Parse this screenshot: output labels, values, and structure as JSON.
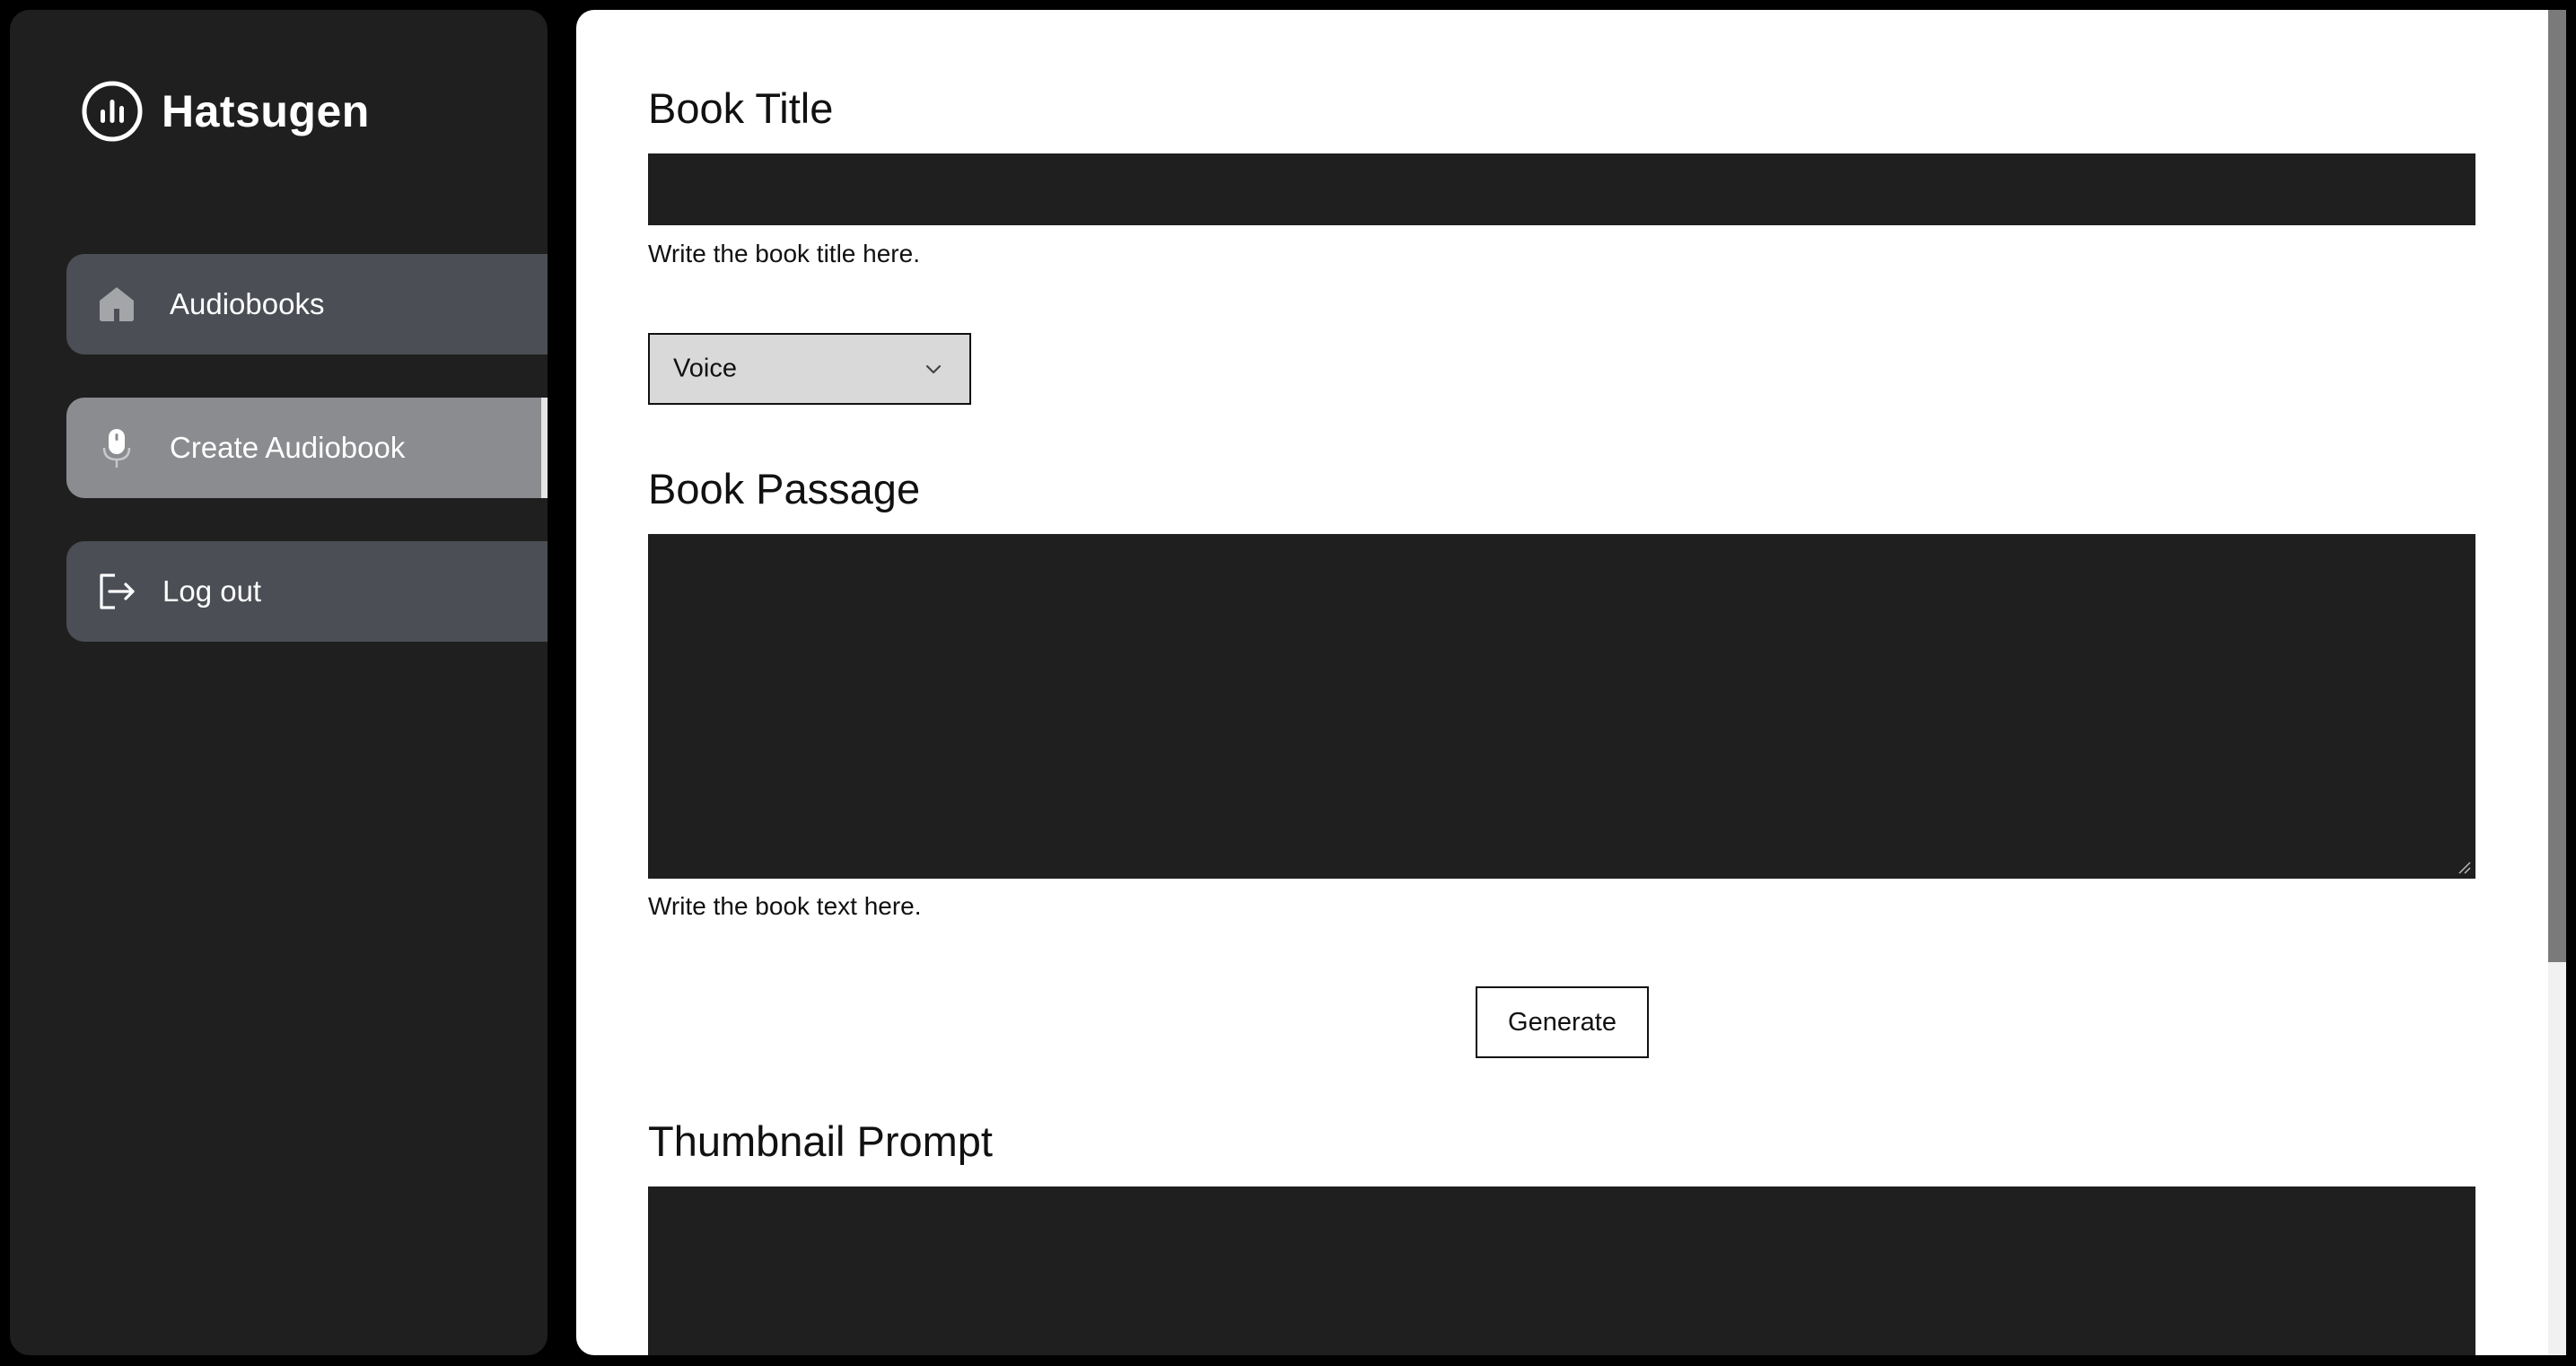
{
  "sidebar": {
    "brand": {
      "name": "Hatsugen",
      "logo_icon": "audio-bars-circle-icon"
    },
    "items": [
      {
        "label": "Audiobooks",
        "icon": "home-icon",
        "active": false
      },
      {
        "label": "Create Audiobook",
        "icon": "microphone-icon",
        "active": true
      },
      {
        "label": "Log out",
        "icon": "logout-icon",
        "active": false
      }
    ]
  },
  "form": {
    "book_title": {
      "heading": "Book Title",
      "value": "",
      "helper": "Write the book title here."
    },
    "voice": {
      "selected": "Voice",
      "icon": "chevron-down-icon"
    },
    "book_passage": {
      "heading": "Book Passage",
      "value": "",
      "helper": "Write the book text here."
    },
    "generate_label": "Generate",
    "thumbnail_prompt": {
      "heading": "Thumbnail Prompt",
      "value": ""
    }
  },
  "colors": {
    "background": "#000000",
    "sidebar_bg": "#1f1f1f",
    "nav_item_bg": "#4b4e55",
    "nav_item_active_bg": "#8a8c8f",
    "main_bg": "#ffffff",
    "field_bg": "#1f1f1f",
    "select_bg": "#d9d9d9"
  }
}
